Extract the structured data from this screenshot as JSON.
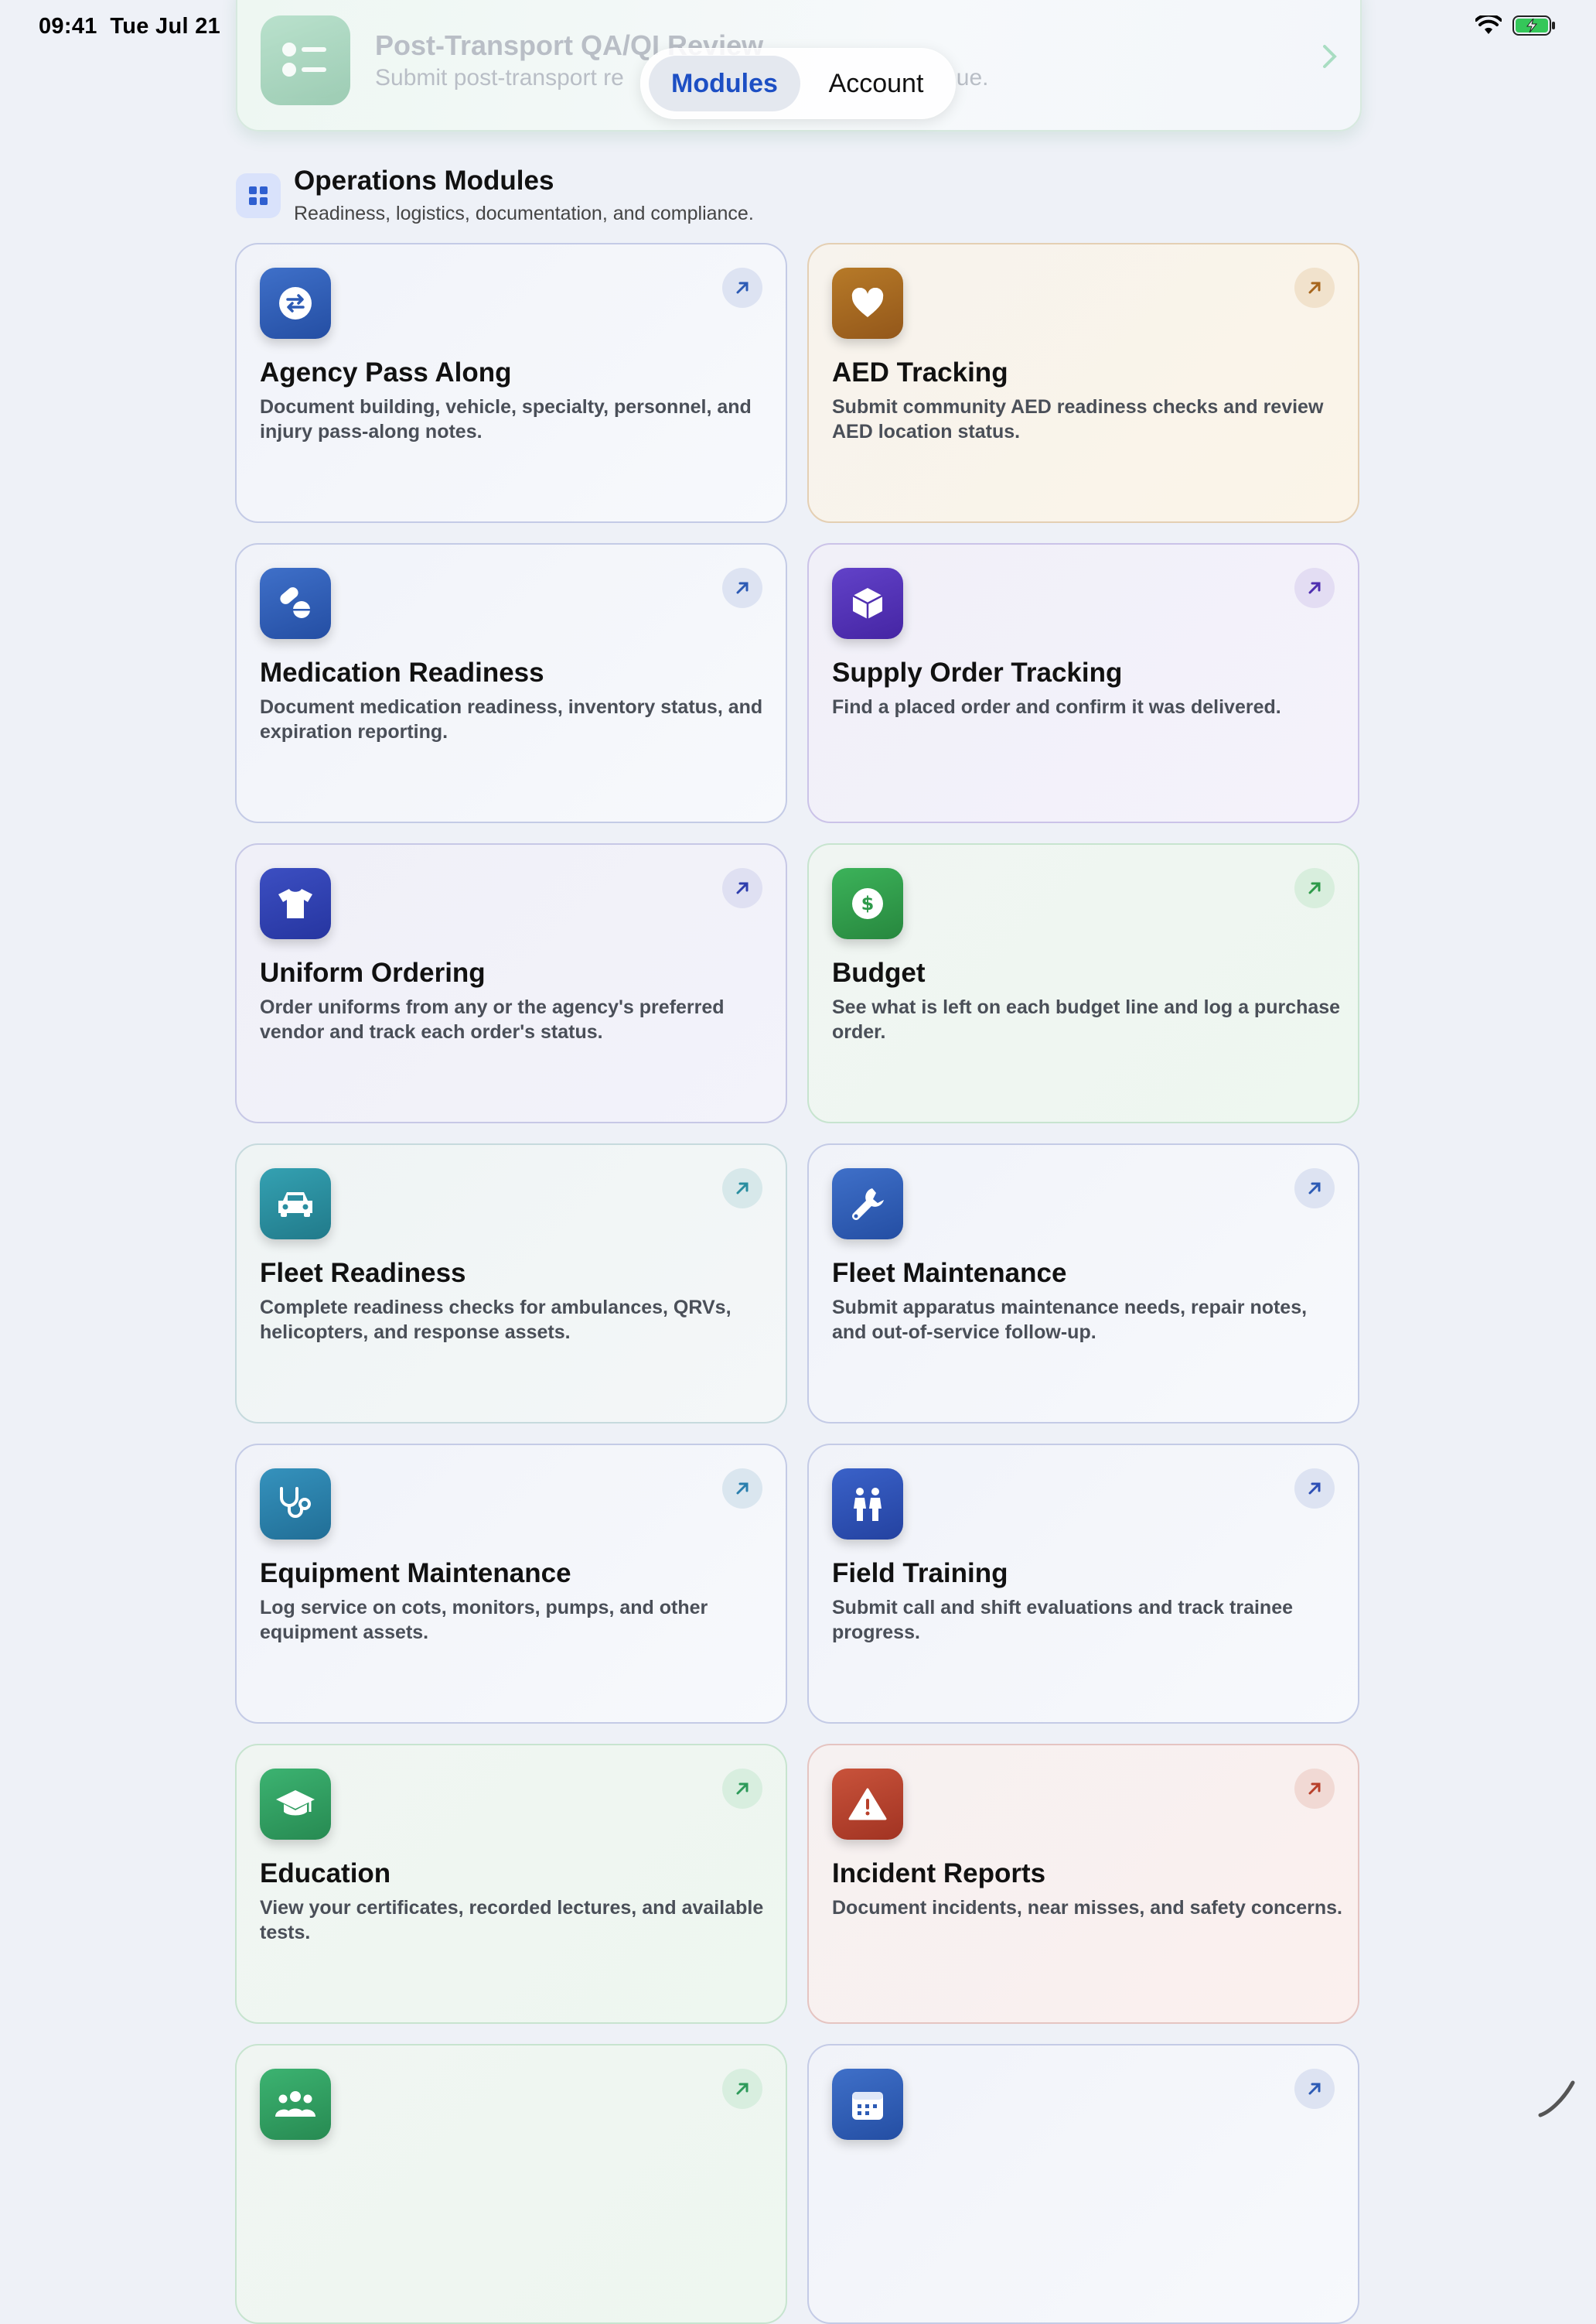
{
  "status_bar": {
    "time": "09:41",
    "date": "Tue Jul 21"
  },
  "top_card": {
    "title": "Post-Transport QA/QI Review",
    "subtitle_left": "Submit post-transport re",
    "subtitle_right": "ue."
  },
  "tabs": {
    "modules": "Modules",
    "account": "Account",
    "selected": "Modules"
  },
  "section": {
    "title": "Operations Modules",
    "subtitle": "Readiness, logistics, documentation, and compliance."
  },
  "modules": [
    {
      "title": "Agency Pass Along",
      "description": "Document building, vehicle, specialty, personnel, and injury pass-along notes.",
      "icon": "swap-arrows-icon",
      "accent": "#2d5bb5"
    },
    {
      "title": "AED Tracking",
      "description": "Submit community AED readiness checks and review AED location status.",
      "icon": "heart-icon",
      "accent": "#a7661d"
    },
    {
      "title": "Medication Readiness",
      "description": "Document medication readiness, inventory status, and expiration reporting.",
      "icon": "pills-icon",
      "accent": "#2d5bb5"
    },
    {
      "title": "Supply Order Tracking",
      "description": "Find a placed order and confirm it was delivered.",
      "icon": "package-icon",
      "accent": "#4f2fb0"
    },
    {
      "title": "Uniform Ordering",
      "description": "Order uniforms from any or the agency's preferred vendor and track each order's status.",
      "icon": "tshirt-icon",
      "accent": "#2f3fae"
    },
    {
      "title": "Budget",
      "description": "See what is left on each budget line and log a purchase order.",
      "icon": "dollar-icon",
      "accent": "#2e9a4a"
    },
    {
      "title": "Fleet Readiness",
      "description": "Complete readiness checks for ambulances, QRVs, helicopters, and response assets.",
      "icon": "car-icon",
      "accent": "#2a8ea0"
    },
    {
      "title": "Fleet Maintenance",
      "description": "Submit apparatus maintenance needs, repair notes, and out-of-service follow-up.",
      "icon": "wrench-icon",
      "accent": "#2d5bb5"
    },
    {
      "title": "Equipment Maintenance",
      "description": "Log service on cots, monitors, pumps, and other equipment assets.",
      "icon": "stethoscope-icon",
      "accent": "#2a7fae"
    },
    {
      "title": "Field Training",
      "description": "Submit call and shift evaluations and track trainee progress.",
      "icon": "people-walking-icon",
      "accent": "#2d4fb5"
    },
    {
      "title": "Education",
      "description": "View your certificates, recorded lectures, and available tests.",
      "icon": "graduation-cap-icon",
      "accent": "#2e9a5a"
    },
    {
      "title": "Incident Reports",
      "description": "Document incidents, near misses, and safety concerns.",
      "icon": "warning-icon",
      "accent": "#b8402b"
    },
    {
      "title": "",
      "description": "",
      "icon": "group-icon",
      "accent": "#2e9a5a"
    },
    {
      "title": "",
      "description": "",
      "icon": "calendar-icon",
      "accent": "#2d5bb5"
    }
  ]
}
